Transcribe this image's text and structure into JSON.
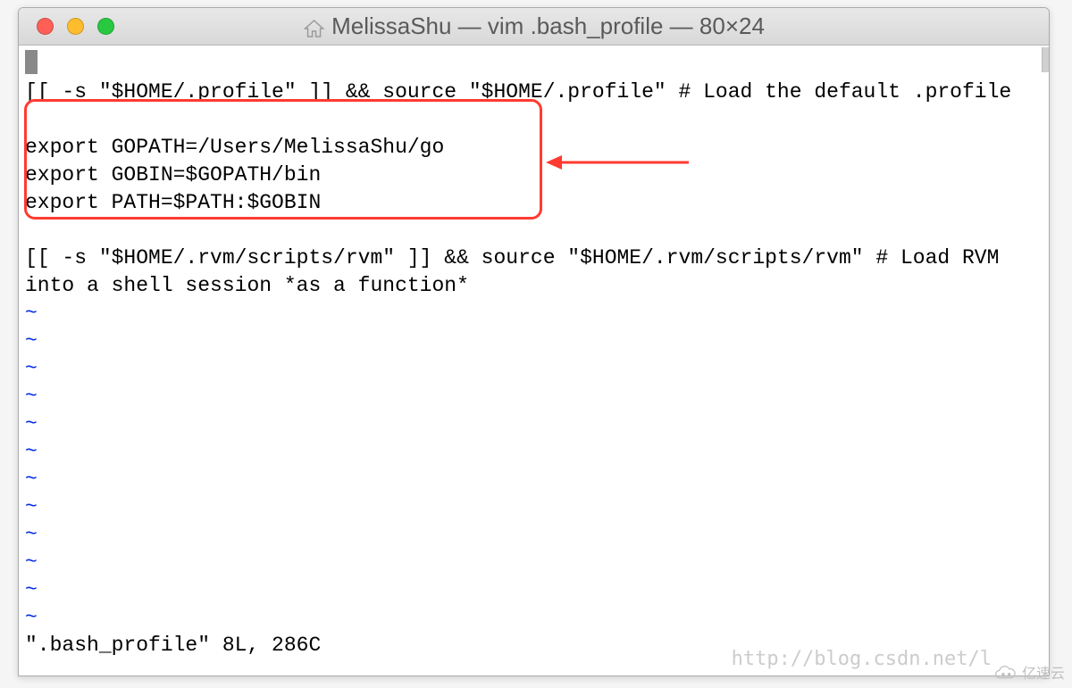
{
  "window": {
    "title": "MelissaShu — vim .bash_profile — 80×24"
  },
  "editor": {
    "line1": "[[ -s \"$HOME/.profile\" ]] && source \"$HOME/.profile\" # Load the default .profile",
    "boxed": {
      "l1": "export GOPATH=/Users/MelissaShu/go",
      "l2": "export GOBIN=$GOPATH/bin",
      "l3": "export PATH=$PATH:$GOBIN"
    },
    "line2a": "[[ -s \"$HOME/.rvm/scripts/rvm\" ]] && source \"$HOME/.rvm/scripts/rvm\" # Load RVM",
    "line2b": "into a shell session *as a function*",
    "tilde": "~",
    "status": "\".bash_profile\" 8L, 286C"
  },
  "watermark": "http://blog.csdn.net/l",
  "footer_label": "亿速云"
}
